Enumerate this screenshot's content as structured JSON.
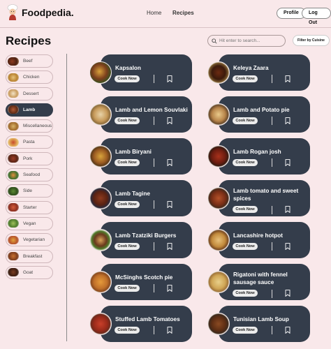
{
  "header": {
    "brand": "Foodpedia.",
    "nav": {
      "home": "Home",
      "recipes": "Recipes"
    },
    "profile_label": "Profile",
    "logout_label": "Log Out"
  },
  "page": {
    "title": "Recipes",
    "search_placeholder": "Hit enter to search...",
    "filter_label": "Filter by Cuisine"
  },
  "sidebar": {
    "items": [
      {
        "label": "Beef",
        "active": false
      },
      {
        "label": "Chicken",
        "active": false
      },
      {
        "label": "Dessert",
        "active": false
      },
      {
        "label": "Lamb",
        "active": true
      },
      {
        "label": "Miscellaneous",
        "active": false
      },
      {
        "label": "Pasta",
        "active": false
      },
      {
        "label": "Pork",
        "active": false
      },
      {
        "label": "Seafood",
        "active": false
      },
      {
        "label": "Side",
        "active": false
      },
      {
        "label": "Starter",
        "active": false
      },
      {
        "label": "Vegan",
        "active": false
      },
      {
        "label": "Vegetarian",
        "active": false
      },
      {
        "label": "Breakfast",
        "active": false
      },
      {
        "label": "Goat",
        "active": false
      }
    ]
  },
  "recipes": {
    "cook_label": "Cook Now",
    "items": [
      {
        "title": "Kapsalon"
      },
      {
        "title": "Keleya Zaara"
      },
      {
        "title": "Lamb and Lemon Souvlaki"
      },
      {
        "title": "Lamb and Potato pie"
      },
      {
        "title": "Lamb Biryani"
      },
      {
        "title": "Lamb Rogan josh"
      },
      {
        "title": "Lamb Tagine"
      },
      {
        "title": "Lamb tomato and sweet spices"
      },
      {
        "title": "Lamb Tzatziki Burgers"
      },
      {
        "title": "Lancashire hotpot"
      },
      {
        "title": "McSinghs Scotch pie"
      },
      {
        "title": "Rigatoni with fennel sausage sauce"
      },
      {
        "title": "Stuffed Lamb Tomatoes"
      },
      {
        "title": "Tunisian Lamb Soup"
      }
    ]
  },
  "colors": {
    "background": "#f9e8ea",
    "card": "#343d4b",
    "active_category": "#343d4b"
  }
}
